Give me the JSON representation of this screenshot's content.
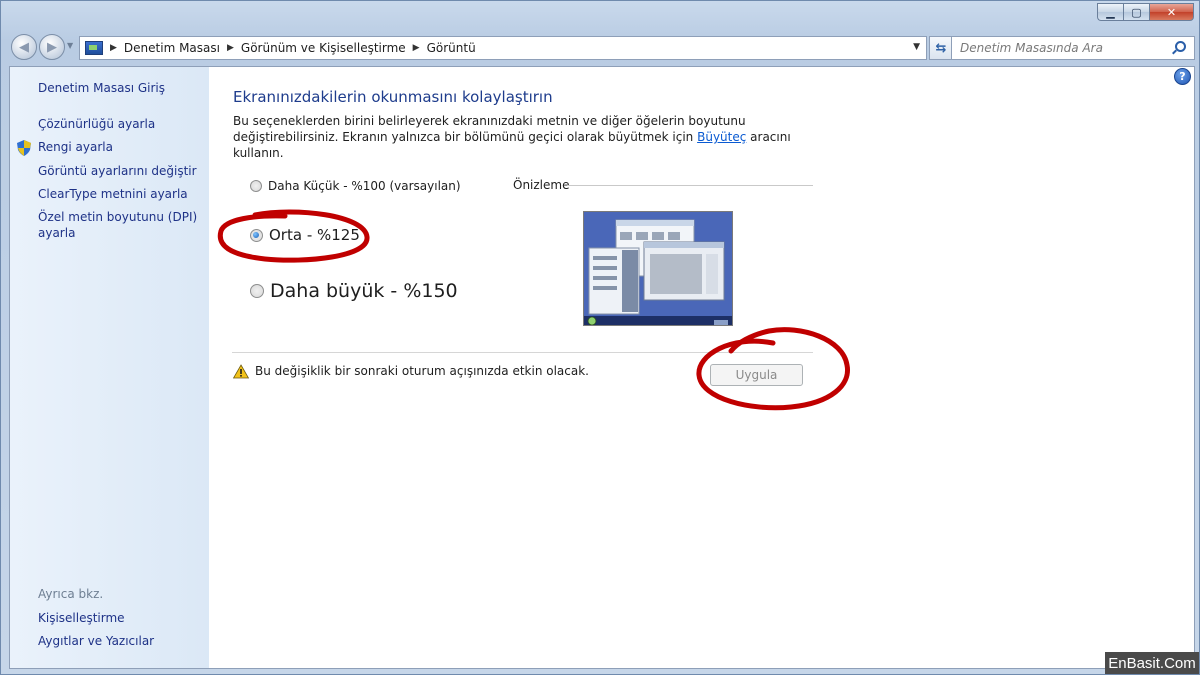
{
  "window": {
    "minimize_glyph": "▁",
    "maximize_glyph": "▢",
    "close_glyph": "✕"
  },
  "address_bar": {
    "crumbs": [
      "Denetim Masası",
      "Görünüm ve Kişiselleştirme",
      "Görüntü"
    ],
    "search_placeholder": "Denetim Masasında Ara"
  },
  "sidebar": {
    "home": "Denetim Masası Giriş",
    "items": [
      {
        "label": "Çözünürlüğü ayarla",
        "icon": ""
      },
      {
        "label": "Rengi ayarla",
        "icon": "uac-shield-icon"
      },
      {
        "label": "Görüntü ayarlarını değiştir",
        "icon": ""
      },
      {
        "label": "ClearType metnini ayarla",
        "icon": ""
      },
      {
        "label": "Özel metin boyutunu (DPI) ayarla",
        "icon": ""
      }
    ],
    "see_also_title": "Ayrıca bkz.",
    "see_also": [
      "Kişiselleştirme",
      "Aygıtlar ve Yazıcılar"
    ]
  },
  "main": {
    "title": "Ekranınızdakilerin okunmasını kolaylaştırın",
    "description_part1": "Bu seçeneklerden birini belirleyerek ekranınızdaki metnin ve diğer öğelerin boyutunu değiştirebilirsiniz. Ekranın yalnızca bir bölümünü geçici olarak büyütmek için ",
    "description_link": "Büyüteç",
    "description_part2": " aracını kullanın.",
    "options": [
      {
        "label": "Daha Küçük - %100 (varsayılan)",
        "selected": false
      },
      {
        "label": "Orta - %125",
        "selected": true
      },
      {
        "label": "Daha büyük - %150",
        "selected": false
      }
    ],
    "preview_label": "Önizleme",
    "warning_text": "Bu değişiklik bir sonraki oturum açışınızda etkin olacak.",
    "apply_label": "Uygula",
    "apply_enabled": false
  },
  "watermark": "EnBasit.Com",
  "colors": {
    "link": "#1e3287",
    "title": "#1e3c8c",
    "annotation": "#c00000"
  }
}
